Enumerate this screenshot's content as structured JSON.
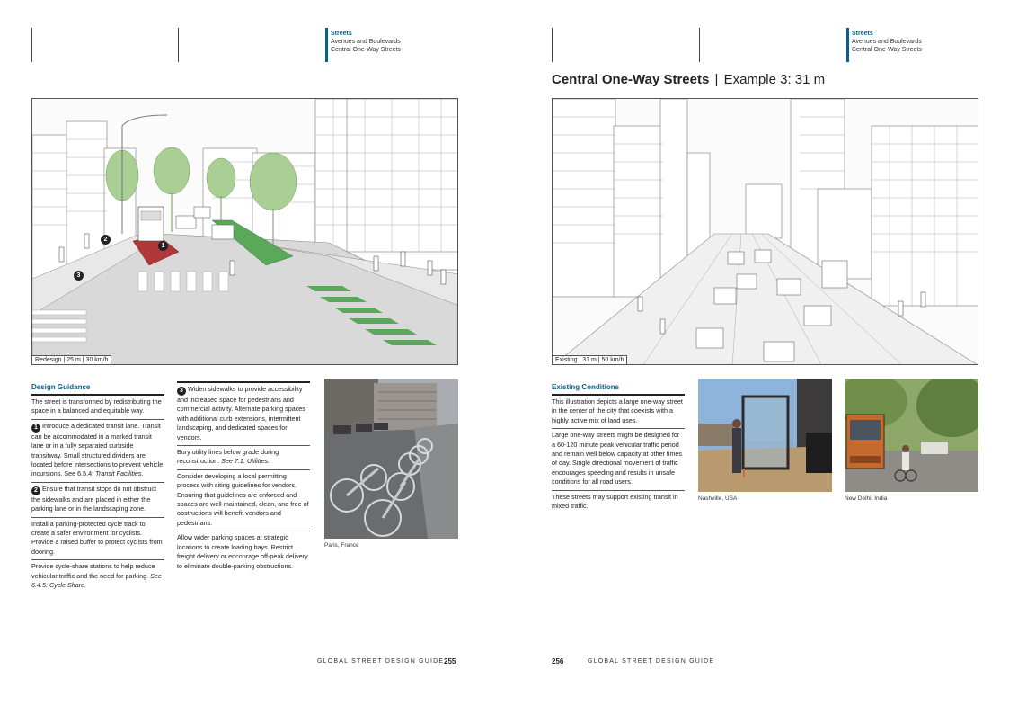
{
  "header": {
    "section": "Streets",
    "line2": "Avenues and Boulevards",
    "line3": "Central One-Way Streets"
  },
  "title": {
    "main": "Central One-Way Streets",
    "separator": "|",
    "sub": "Example 3: 31 m"
  },
  "left_illustration": {
    "caption": "Redesign | 25 m | 30 km/h",
    "markers": [
      "1",
      "2",
      "3"
    ]
  },
  "right_illustration": {
    "caption": "Existing | 31 m | 50 km/h"
  },
  "design_guidance": {
    "heading": "Design Guidance",
    "p1": "The street is transformed by redistributing the space in a balanced and equitable way.",
    "p2_num": "1",
    "p2": "Introduce a dedicated transit lane. Transit can be accommodated in a marked transit lane or in a fully separated curbside transitway. Small structured dividers are located before intersections to prevent vehicle incursions. See 6.5.4: ",
    "p2_ref": "Transit Facilities.",
    "p3_num": "2",
    "p3": "Ensure that transit stops do not obstruct the sidewalks and are placed in either the parking lane or in the landscaping zone.",
    "p4": "Install a parking-protected cycle track to create a safer environment for cyclists. Provide a raised buffer to protect cyclists from dooring.",
    "p5": "Provide cycle-share stations to help reduce vehicular traffic and the need for parking. ",
    "p5_ref": "See 6.4.5: Cycle Share."
  },
  "design_guidance_col2": {
    "p1_num": "3",
    "p1": "Widen sidewalks to provide accessibility and increased space for pedestrians and commercial activity. Alternate parking spaces with additional curb extensions, intermittent landscaping, and dedicated spaces for vendors.",
    "p2": "Bury utility lines below grade during reconstruction. ",
    "p2_ref": "See 7.1: Utilities.",
    "p3": "Consider developing a local permitting process with siting guidelines for vendors. Ensuring that guidelines are enforced and spaces are well-maintained, clean, and free of obstructions will benefit vendors and pedestrians.",
    "p4": "Allow wider parking spaces at strategic locations to create loading bays. Restrict freight delivery or encourage off-peak delivery to eliminate double-parking obstructions."
  },
  "existing_conditions": {
    "heading": "Existing Conditions",
    "p1": "This illustration depicts a large one-way street in the center of the city that coexists with a highly active mix of land uses.",
    "p2": "Large one-way streets might be designed for a 60-120 minute peak vehicular traffic period and remain well below capacity at other times of day. Single directional movement of traffic encourages speeding and results in unsafe conditions for all road users.",
    "p3": "These streets may support existing transit in mixed traffic."
  },
  "photos": {
    "paris": "Paris, France",
    "nashville": "Nashville, USA",
    "delhi": "New Delhi, India"
  },
  "footer": {
    "left_text": "GLOBAL STREET DESIGN GUIDE",
    "left_page": "255",
    "right_page": "256",
    "right_text": "GLOBAL STREET DESIGN GUIDE"
  },
  "colors": {
    "accent": "#0a5f86",
    "transit_lane": "#b0383a",
    "cycle_track": "#5aa85a",
    "tree": "#a9cf95"
  }
}
